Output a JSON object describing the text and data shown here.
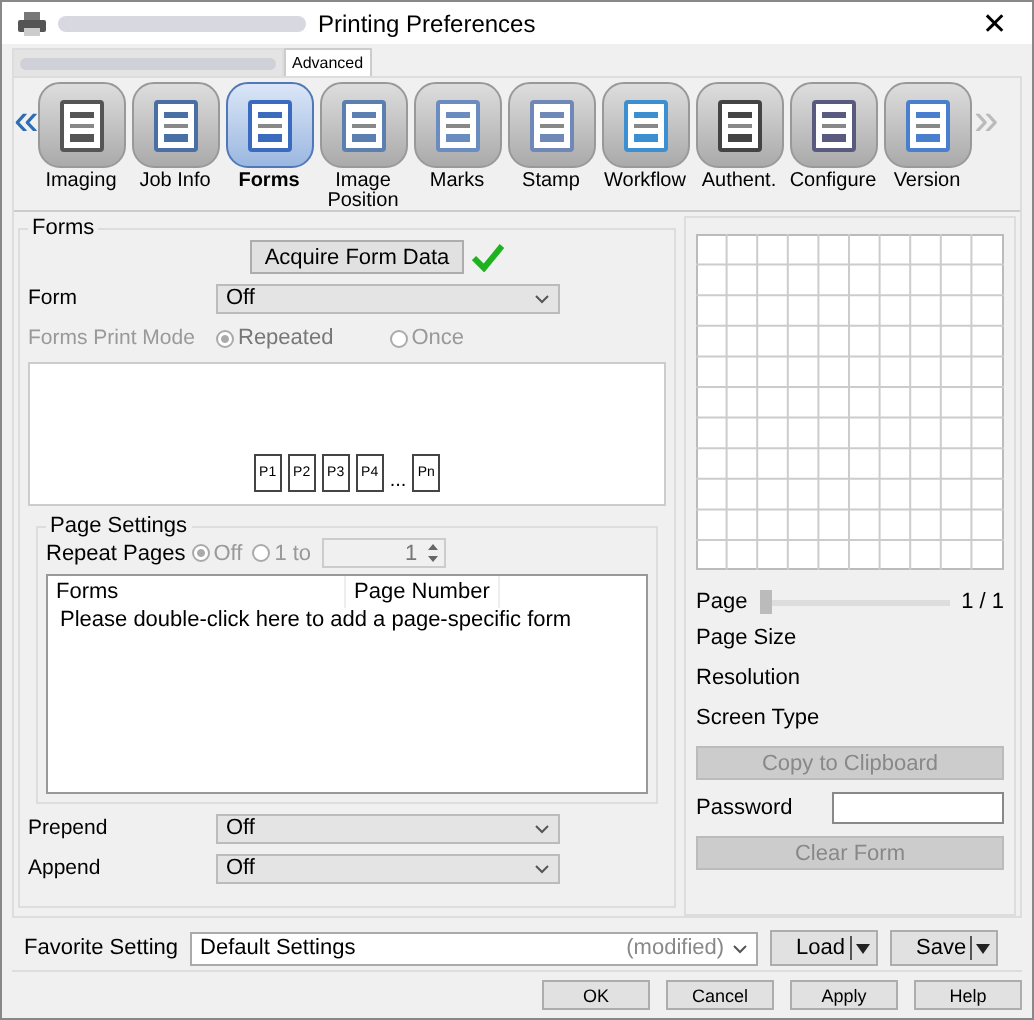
{
  "window": {
    "title": "Printing Preferences",
    "close": "✕"
  },
  "tabs": [
    {
      "selected": false
    },
    {
      "label": "Advanced",
      "selected": true
    }
  ],
  "toolbar": {
    "prev": "«",
    "next": "»",
    "items": [
      {
        "label": "Imaging",
        "selected": false
      },
      {
        "label": "Job Info",
        "selected": false
      },
      {
        "label": "Forms",
        "selected": true
      },
      {
        "label": "Image Position",
        "selected": false
      },
      {
        "label": "Marks",
        "selected": false
      },
      {
        "label": "Stamp",
        "selected": false
      },
      {
        "label": "Workflow",
        "selected": false
      },
      {
        "label": "Authent.",
        "selected": false
      },
      {
        "label": "Configure",
        "selected": false
      },
      {
        "label": "Version",
        "selected": false
      }
    ]
  },
  "forms": {
    "title": "Forms",
    "acquire_button": "Acquire Form Data",
    "acquired": true,
    "form_label": "Form",
    "form_value": "Off",
    "print_mode": {
      "label": "Forms Print Mode",
      "disabled": true,
      "options": [
        {
          "label": "Repeated",
          "selected": true
        },
        {
          "label": "Once",
          "selected": false
        }
      ]
    },
    "preview_pages": [
      "P1",
      "P2",
      "P3",
      "P4",
      "Pn"
    ],
    "preview_ellipsis": "...",
    "page_settings": {
      "title": "Page Settings",
      "repeat_label": "Repeat Pages",
      "options": [
        {
          "label": "Off",
          "selected": true
        },
        {
          "label": "1 to",
          "selected": false
        }
      ],
      "repeat_value": "1",
      "columns": [
        "Forms",
        "Page Number"
      ],
      "hint": "Please double-click here to add a page-specific form"
    },
    "prepend_label": "Prepend",
    "prepend_value": "Off",
    "append_label": "Append",
    "append_value": "Off"
  },
  "preview": {
    "page_label": "Page",
    "page_slider": {
      "level": 0
    },
    "page_reading": "1 / 1",
    "page_size_label": "Page Size",
    "resolution_label": "Resolution",
    "screen_type_label": "Screen Type",
    "copy_button": "Copy to Clipboard",
    "password_label": "Password",
    "clear_button": "Clear Form"
  },
  "favorite": {
    "label": "Favorite Setting",
    "value": "Default Settings",
    "modified": "(modified)",
    "load": "Load",
    "save": "Save"
  },
  "buttons": [
    "OK",
    "Cancel",
    "Apply",
    "Help"
  ]
}
